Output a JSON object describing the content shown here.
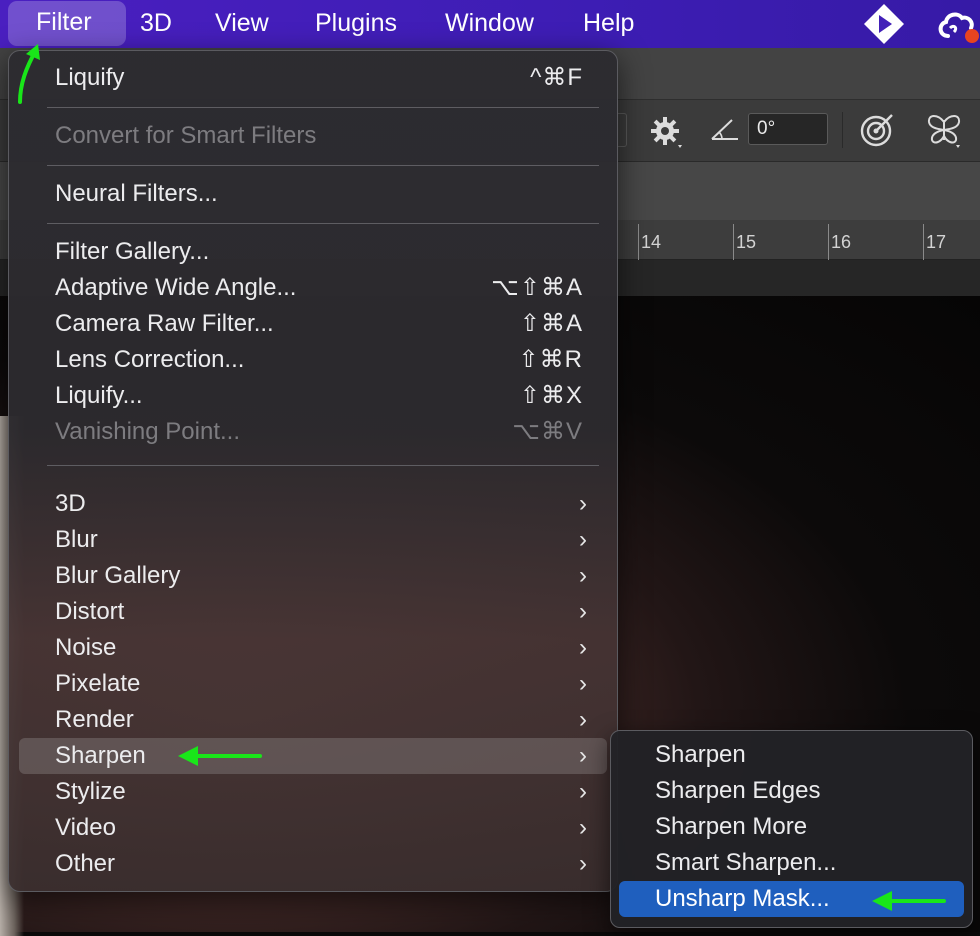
{
  "menubar": {
    "items": [
      {
        "label": "Filter",
        "active": true
      },
      {
        "label": "3D"
      },
      {
        "label": "View"
      },
      {
        "label": "Plugins"
      },
      {
        "label": "Window"
      },
      {
        "label": "Help"
      }
    ]
  },
  "toolbar": {
    "angle_value": "0°"
  },
  "ruler": {
    "labels": [
      "14",
      "15",
      "16",
      "17"
    ]
  },
  "filter_menu": {
    "items": [
      {
        "label": "Liquify",
        "shortcut": "^⌘F"
      },
      {
        "label": "Convert for Smart Filters",
        "disabled": true
      },
      {
        "label": "Neural Filters..."
      },
      {
        "label": "Filter Gallery..."
      },
      {
        "label": "Adaptive Wide Angle...",
        "shortcut": "⌥⇧⌘A"
      },
      {
        "label": "Camera Raw Filter...",
        "shortcut": "⇧⌘A"
      },
      {
        "label": "Lens Correction...",
        "shortcut": "⇧⌘R"
      },
      {
        "label": "Liquify...",
        "shortcut": "⇧⌘X"
      },
      {
        "label": "Vanishing Point...",
        "shortcut": "⌥⌘V",
        "disabled": true
      },
      {
        "label": "3D",
        "submenu": true
      },
      {
        "label": "Blur",
        "submenu": true
      },
      {
        "label": "Blur Gallery",
        "submenu": true
      },
      {
        "label": "Distort",
        "submenu": true
      },
      {
        "label": "Noise",
        "submenu": true
      },
      {
        "label": "Pixelate",
        "submenu": true
      },
      {
        "label": "Render",
        "submenu": true
      },
      {
        "label": "Sharpen",
        "submenu": true,
        "highlighted": true
      },
      {
        "label": "Stylize",
        "submenu": true
      },
      {
        "label": "Video",
        "submenu": true
      },
      {
        "label": "Other",
        "submenu": true
      }
    ],
    "chevron": "›"
  },
  "sharpen_submenu": {
    "items": [
      {
        "label": "Sharpen"
      },
      {
        "label": "Sharpen Edges"
      },
      {
        "label": "Sharpen More"
      },
      {
        "label": "Smart Sharpen..."
      },
      {
        "label": "Unsharp Mask...",
        "selected": true
      }
    ]
  },
  "colors": {
    "menubar": "#4a1fc0",
    "selection_blue": "#1f5fbe",
    "annotation_green": "#19e619"
  }
}
